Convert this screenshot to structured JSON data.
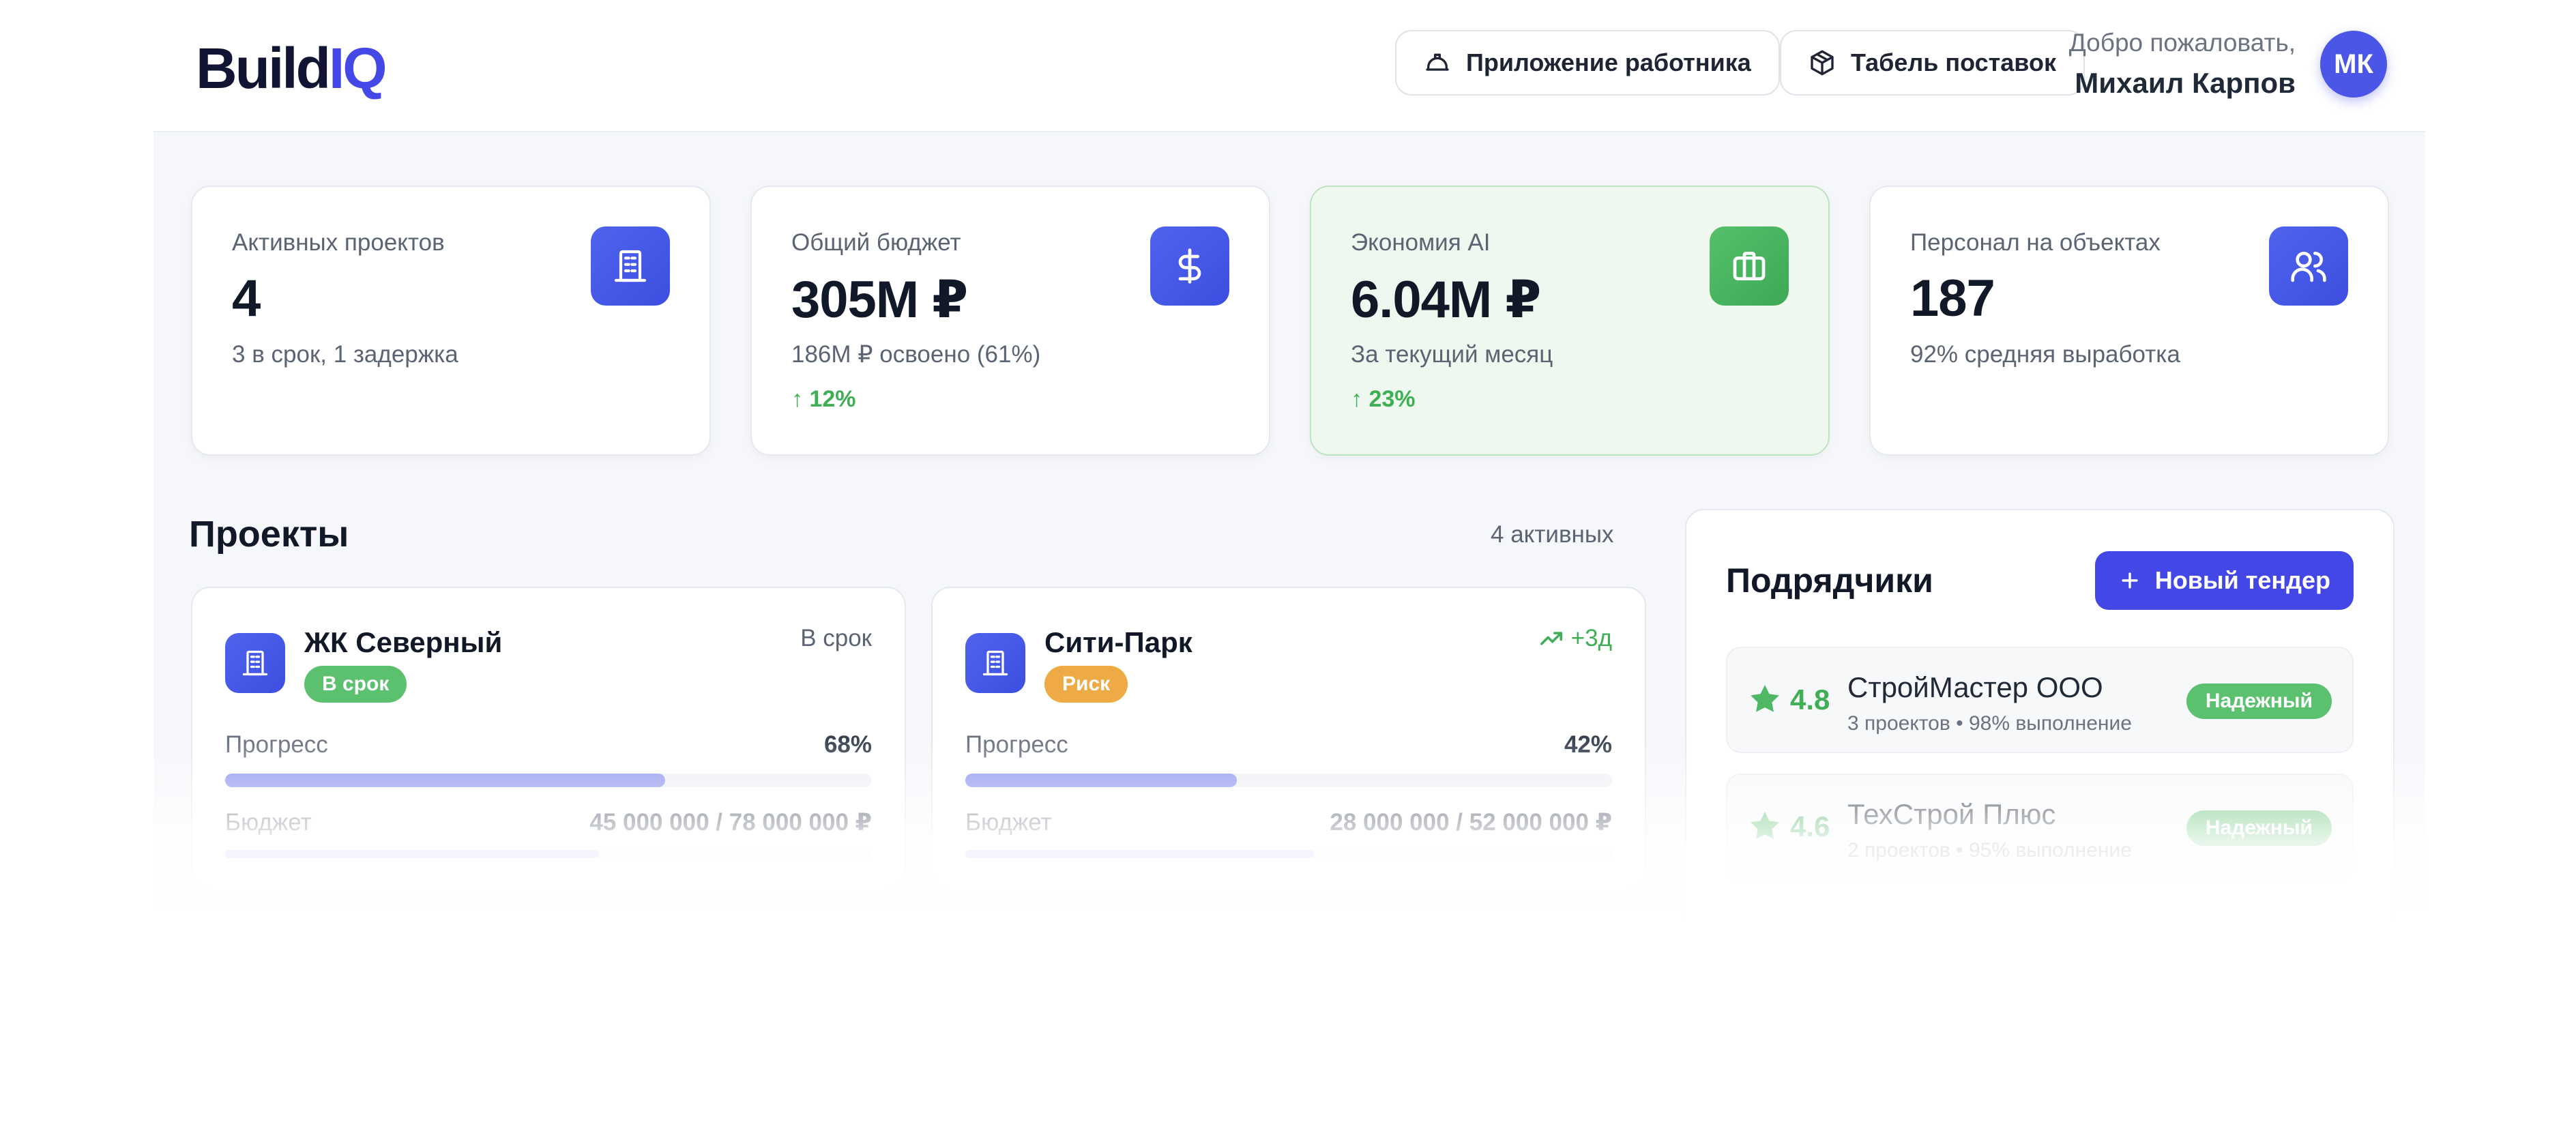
{
  "header": {
    "logo_main": "Build",
    "logo_accent": "IQ",
    "worker_app_label": "Приложение работника",
    "supply_label": "Табель поставок",
    "welcome_text": "Добро пожаловать,",
    "user_name": "Михаил Карпов",
    "avatar_initials": "МК"
  },
  "stats": [
    {
      "label": "Активных проектов",
      "value": "4",
      "sub": "3 в срок, 1 задержка",
      "trend": "",
      "icon": "building-icon"
    },
    {
      "label": "Общий бюджет",
      "value": "305M ₽",
      "sub": "186M ₽ освоено (61%)",
      "trend": "12%",
      "icon": "dollar-icon"
    },
    {
      "label": "Экономия AI",
      "value": "6.04M ₽",
      "sub": "За текущий месяц",
      "trend": "23%",
      "icon": "briefcase-icon"
    },
    {
      "label": "Персонал на объектах",
      "value": "187",
      "sub": "92% средняя выработка",
      "trend": "",
      "icon": "users-icon"
    }
  ],
  "projects": {
    "title": "Проекты",
    "count": "4 активных",
    "items": [
      {
        "name": "ЖК Северный",
        "badge": "В срок",
        "badge_color": "#5cc16e",
        "status": "В срок",
        "progress_label": "Прогресс",
        "progress_value": "68%",
        "progress": 0.68,
        "budget_label": "Бюджет",
        "budget_value": "45 000 000 / 78 000 000 ₽",
        "budget": 0.577
      },
      {
        "name": "Сити-Парк",
        "badge": "Риск",
        "badge_color": "#eeaa45",
        "status": "+3д",
        "progress_label": "Прогресс",
        "progress_value": "42%",
        "progress": 0.42,
        "budget_label": "Бюджет",
        "budget_value": "28 000 000 / 52 000 000 ₽",
        "budget": 0.538
      }
    ]
  },
  "contractors": {
    "title": "Подрядчики",
    "new_tender_label": "Новый тендер",
    "items": [
      {
        "rating": "4.8",
        "name": "СтройМастер ООО",
        "meta": "3 проектов • 98% выполнение",
        "badge": "Надежный"
      },
      {
        "rating": "4.6",
        "name": "ТехСтрой Плюс",
        "meta": "2 проектов • 95% выполнение",
        "badge": "Надежный"
      }
    ]
  },
  "colors": {
    "accent": "#4347e6",
    "success": "#3fae55",
    "warning": "#eeaa45"
  }
}
